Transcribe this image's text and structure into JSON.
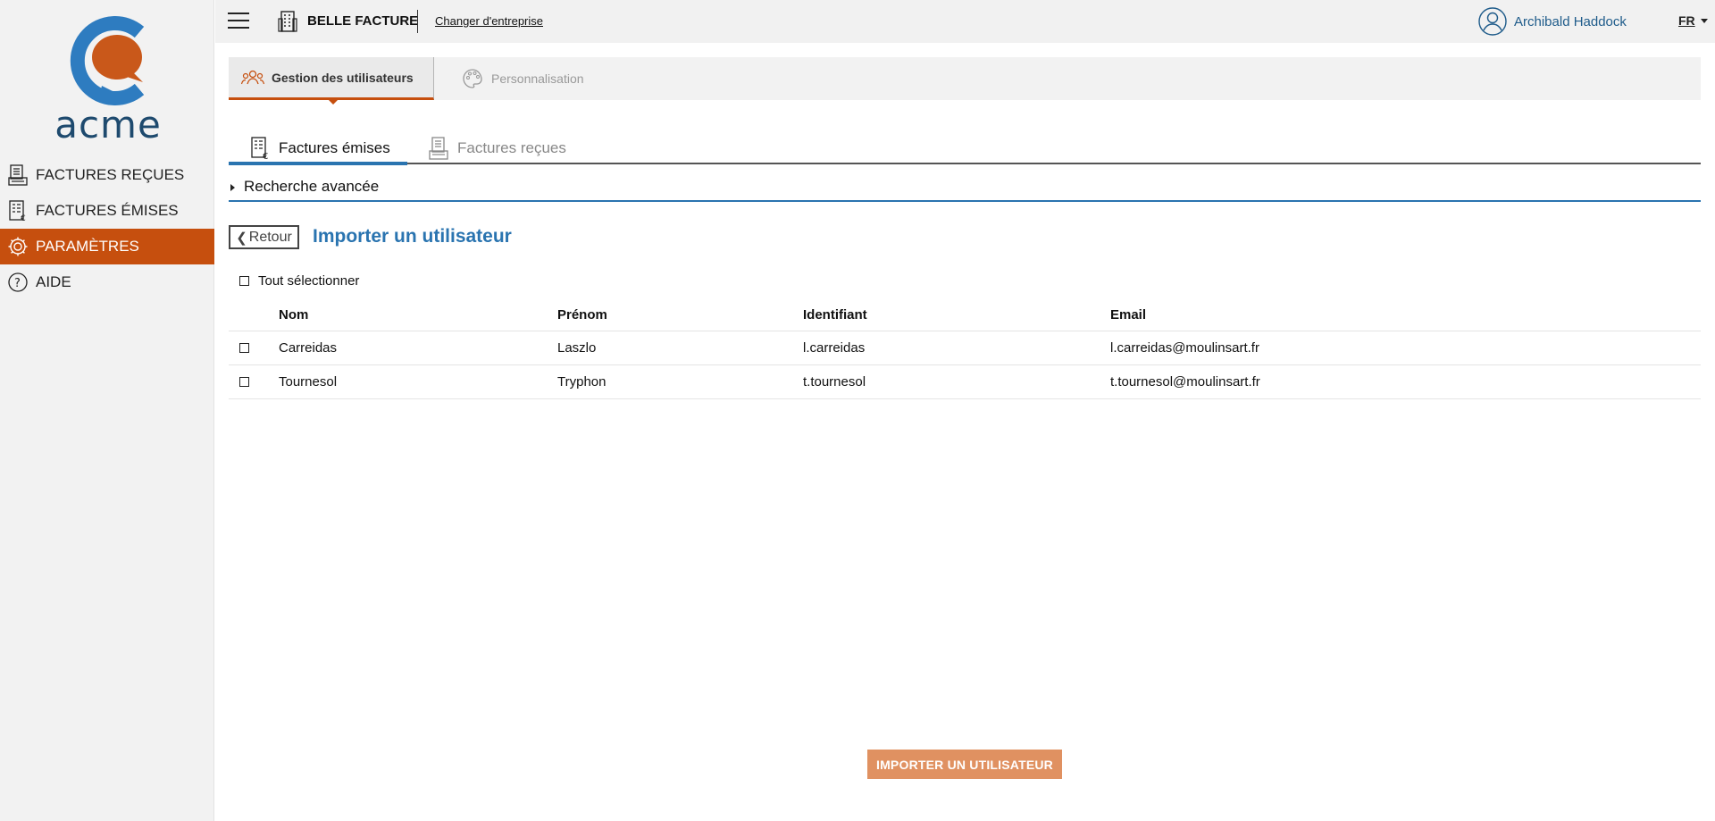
{
  "sidebar": {
    "logo_text": "acme",
    "items": [
      {
        "label": "FACTURES REÇUES",
        "icon": "received-invoice-icon"
      },
      {
        "label": "FACTURES ÉMISES",
        "icon": "sent-invoice-icon"
      },
      {
        "label": "PARAMÈTRES",
        "icon": "gear-icon",
        "active": true
      },
      {
        "label": "AIDE",
        "icon": "help-icon"
      }
    ],
    "active_color": "#c64f0e"
  },
  "topbar": {
    "company_name": "BELLE FACTURE",
    "switch_company": "Changer d'entreprise",
    "user_name": "Archibald Haddock",
    "language": "FR"
  },
  "settings_tabs": [
    {
      "label": "Gestion des utilisateurs",
      "icon": "users-icon",
      "active": true
    },
    {
      "label": "Personnalisation",
      "icon": "palette-icon",
      "active": false
    }
  ],
  "invoice_tabs": [
    {
      "label": "Factures émises",
      "icon": "sent-invoice-icon",
      "active": true
    },
    {
      "label": "Factures reçues",
      "icon": "received-invoice-icon",
      "active": false
    }
  ],
  "advanced_search": {
    "label": "Recherche avancée"
  },
  "back_button": {
    "label": "Retour"
  },
  "page_title": "Importer un utilisateur",
  "select_all": {
    "label": "Tout sélectionner",
    "checked": false
  },
  "table": {
    "columns": [
      "Nom",
      "Prénom",
      "Identifiant",
      "Email"
    ],
    "rows": [
      {
        "nom": "Carreidas",
        "prenom": "Laszlo",
        "identifiant": "l.carreidas",
        "email": "l.carreidas@moulinsart.fr",
        "checked": false
      },
      {
        "nom": "Tournesol",
        "prenom": "Tryphon",
        "identifiant": "t.tournesol",
        "email": "t.tournesol@moulinsart.fr",
        "checked": false
      }
    ]
  },
  "import_button": {
    "label": "IMPORTER UN UTILISATEUR"
  },
  "colors": {
    "primary_blue": "#2a74b0",
    "accent_orange": "#c64f0e",
    "import_button": "#e09161"
  }
}
